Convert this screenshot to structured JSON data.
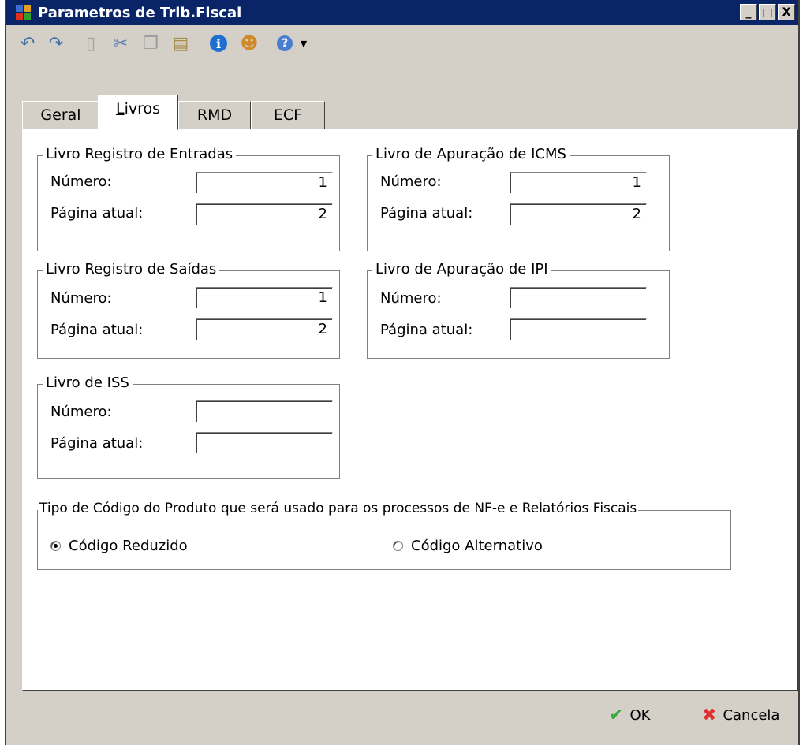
{
  "window": {
    "title": "Parametros de Trib.Fiscal",
    "controls": {
      "minimize": "_",
      "maximize": "□",
      "close": "X"
    }
  },
  "toolbar": [
    {
      "name": "undo-icon",
      "glyph": "↶",
      "color": "#3c6ea8"
    },
    {
      "name": "redo-icon",
      "glyph": "↷",
      "color": "#3c6ea8"
    },
    {
      "name": "new-document-icon",
      "glyph": "▯",
      "color": "#a0a0a0"
    },
    {
      "name": "cut-icon",
      "glyph": "✂",
      "color": "#5a7fb0"
    },
    {
      "name": "copy-icon",
      "glyph": "❐",
      "color": "#9a9a9a"
    },
    {
      "name": "paste-icon",
      "glyph": "▤",
      "color": "#a88c4a"
    },
    {
      "name": "info-icon",
      "glyph": "i",
      "color": "#1f6fd0"
    },
    {
      "name": "user-icon",
      "glyph": "☻",
      "color": "#d08a2a"
    },
    {
      "name": "help-icon",
      "glyph": "?",
      "color": "#3070c0"
    },
    {
      "name": "chevron-down-icon",
      "glyph": "▼",
      "color": "#000000"
    }
  ],
  "tabs": [
    {
      "pre": "G",
      "ul": "e",
      "post": "ral"
    },
    {
      "pre": "",
      "ul": "L",
      "post": "ivros"
    },
    {
      "pre": "",
      "ul": "R",
      "post": "MD"
    },
    {
      "pre": "",
      "ul": "E",
      "post": "CF"
    }
  ],
  "groups": {
    "entradas": {
      "legend": "Livro Registro de Entradas",
      "numero_label": "Número:",
      "pagina_label": "Página atual:",
      "numero": "1",
      "pagina": "2"
    },
    "saidas": {
      "legend": "Livro Registro de Saídas",
      "numero_label": "Número:",
      "pagina_label": "Página atual:",
      "numero": "1",
      "pagina": "2"
    },
    "iss": {
      "legend": "Livro de ISS",
      "numero_label": "Número:",
      "pagina_label": "Página atual:",
      "numero": "",
      "pagina": ""
    },
    "icms": {
      "legend": "Livro de Apuração de ICMS",
      "numero_label": "Número:",
      "pagina_label": "Página atual:",
      "numero": "1",
      "pagina": "2"
    },
    "ipi": {
      "legend": "Livro de Apuração de IPI",
      "numero_label": "Número:",
      "pagina_label": "Página atual:",
      "numero": "",
      "pagina": ""
    }
  },
  "codigo": {
    "legend": "Tipo de Código do Produto que será usado para os processos de NF-e e Relatórios Fiscais",
    "option_reduzido": "Código Reduzido",
    "option_alternativo": "Código Alternativo"
  },
  "buttons": {
    "ok": {
      "ul": "O",
      "post": "K",
      "icon_color": "#3aa83a"
    },
    "cancela": {
      "ul": "C",
      "post": "ancela",
      "icon_color": "#e03030"
    }
  }
}
